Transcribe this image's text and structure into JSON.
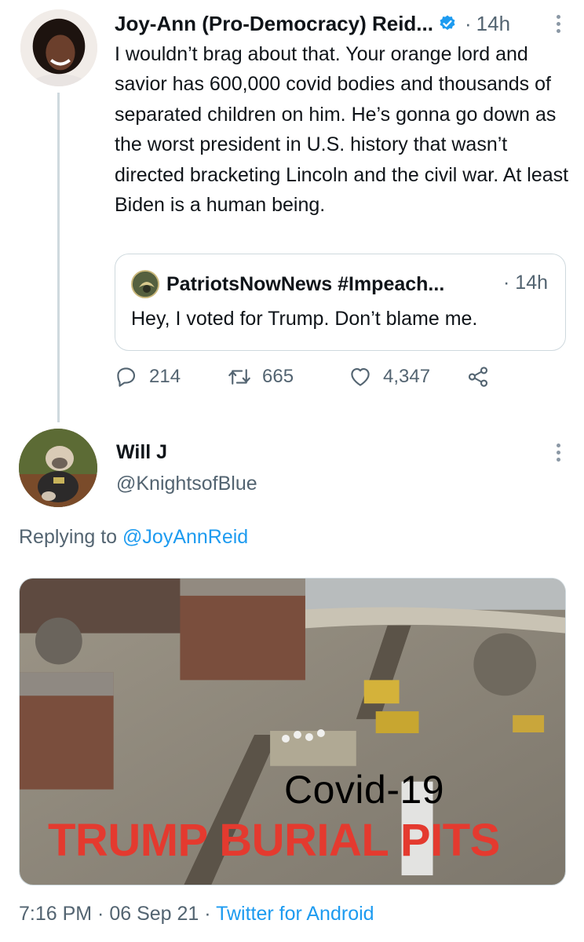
{
  "tweet1": {
    "display_name": "Joy-Ann (Pro-Democracy) Reid...",
    "separator": "·",
    "time": "14h",
    "text": "I wouldn’t brag about that. Your orange lord and savior has 600,000 covid bodies and thousands of separated children on him. He’s gonna go down as the worst president in U.S. history that wasn’t directed bracketing Lincoln and the civil war. At least Biden is a human being.",
    "quote": {
      "display_name": "PatriotsNowNews #Impeach...",
      "time": "· 14h",
      "text": "Hey, I voted for Trump. Don’t blame me."
    },
    "actions": {
      "replies": "214",
      "retweets": "665",
      "likes": "4,347"
    }
  },
  "tweet2": {
    "display_name": "Will J",
    "handle": "@KnightsofBlue",
    "replying_prefix": "Replying to ",
    "replying_to": "@JoyAnnReid",
    "media_overlay": {
      "line1": "Covid-19",
      "line2": "TRUMP BURIAL PITS"
    },
    "meta": {
      "time": "7:16 PM · 06 Sep 21 · ",
      "source": "Twitter for Android"
    }
  },
  "colors": {
    "link": "#1d9bf0",
    "secondary_text": "#536471",
    "overlay_red": "#e43a2f"
  }
}
